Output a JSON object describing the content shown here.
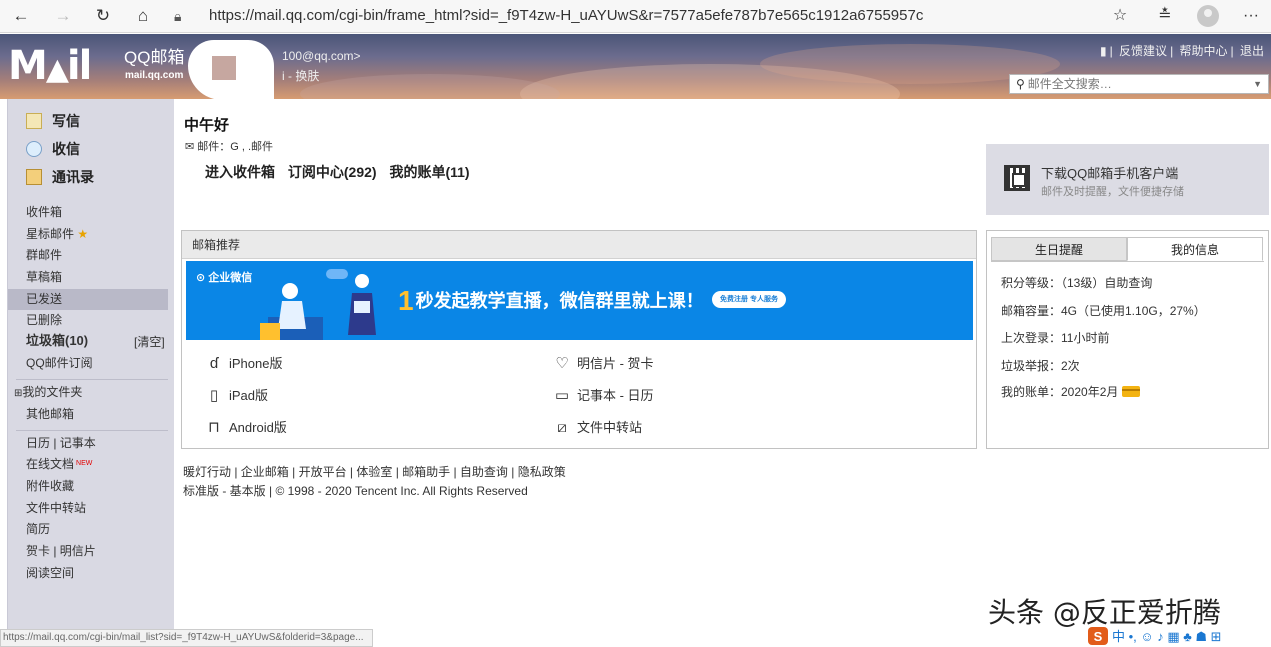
{
  "browser": {
    "url": "https://mail.qq.com/cgi-bin/frame_html?sid=_f9T4zw-H_uAYUwS&r=7577a5efe787b7e565c1912a6755957c"
  },
  "header": {
    "logo_text": "M",
    "logo_title": "QQ邮箱",
    "logo_url": "mail.qq.com",
    "email_suffix": "100@qq.com>",
    "skin_link": "i - 换肤",
    "links": [
      "反馈建议",
      "帮助中心",
      "退出"
    ],
    "search_placeholder": "邮件全文搜索…"
  },
  "sidebar": {
    "compose": "写信",
    "inbox": "收信",
    "contacts": "通讯录",
    "items": [
      "收件箱",
      "星标邮件",
      "群邮件",
      "草稿箱",
      "已发送",
      "已删除",
      "垃圾箱(10)",
      "QQ邮件订阅",
      "我的文件夹",
      "其他邮箱",
      "日历 | 记事本",
      "在线文档",
      "附件收藏",
      "文件中转站",
      "简历",
      "贺卡 | 明信片",
      "阅读空间"
    ],
    "clear_label": "[清空]",
    "new_badge": "NEW",
    "selected_item": "已发送"
  },
  "main": {
    "greeting": "中午好",
    "mail_line": "邮件：G ,         .邮件",
    "quick_links": [
      "进入收件箱",
      "订阅中心(292)",
      "我的账单(11)"
    ]
  },
  "promo": {
    "title": "下载QQ邮箱手机客户端",
    "subtitle": "邮件及时提醒，文件便捷存储"
  },
  "recommend": {
    "title": "邮箱推荐",
    "banner_brand": "企业微信",
    "banner_number": "1",
    "banner_text": "秒发起教学直播，微信群里就上课！",
    "banner_pill": "免费注册 专人服务",
    "apps": [
      {
        "icon": "apple-icon",
        "label": "iPhone版"
      },
      {
        "icon": "heart-icon",
        "label": "明信片 - 贺卡"
      },
      {
        "icon": "tablet-icon",
        "label": "iPad版"
      },
      {
        "icon": "calendar-icon",
        "label": "记事本 - 日历"
      },
      {
        "icon": "android-icon",
        "label": "Android版"
      },
      {
        "icon": "transfer-icon",
        "label": "文件中转站"
      }
    ]
  },
  "info": {
    "tab_birthday": "生日提醒",
    "tab_myinfo": "我的信息",
    "rows": [
      "积分等级：（13级）自助查询",
      "邮箱容量：4G（已使用1.10G，27%）",
      "上次登录：11小时前",
      "垃圾举报：2次",
      "我的账单：2020年2月"
    ]
  },
  "footer": {
    "line1": "暖灯行动 | 企业邮箱 | 开放平台 | 体验室 | 邮箱助手 | 自助查询 | 隐私政策",
    "line2": "标准版 - 基本版 | © 1998 - 2020 Tencent Inc. All Rights Reserved"
  },
  "status_url": "https://mail.qq.com/cgi-bin/mail_list?sid=_f9T4zw-H_uAYUwS&folderid=3&page...",
  "watermark": "头条 @反正爱折腾",
  "ime": "中 •, ☺ ♪ ▦ ♣ ☗ ⊞"
}
